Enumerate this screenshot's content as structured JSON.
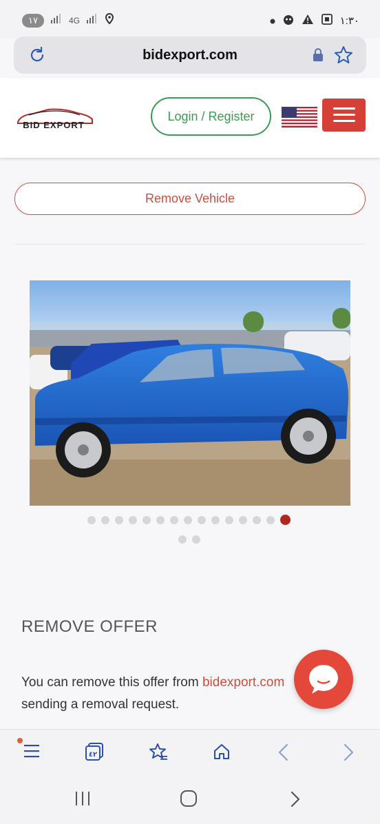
{
  "status_bar": {
    "notification_count": "١٧",
    "network": "4G",
    "time": "١:٣٠"
  },
  "url_bar": {
    "url": "bidexport.com"
  },
  "header": {
    "logo_text": "BID EXPORT",
    "login_label": "Login / Register"
  },
  "vehicle": {
    "remove_label": "Remove Vehicle",
    "image_count": 17,
    "active_image_index": 15
  },
  "offer": {
    "title": "REMOVE OFFER",
    "text_before": "You can remove this offer from ",
    "link_text": "bidexport.com",
    "text_after": " sending a removal request."
  },
  "browser_toolbar": {
    "tabs_count": "٤٢"
  },
  "colors": {
    "brand_red": "#d63f35",
    "login_green": "#3a9b52",
    "accent_link": "#c95040"
  }
}
